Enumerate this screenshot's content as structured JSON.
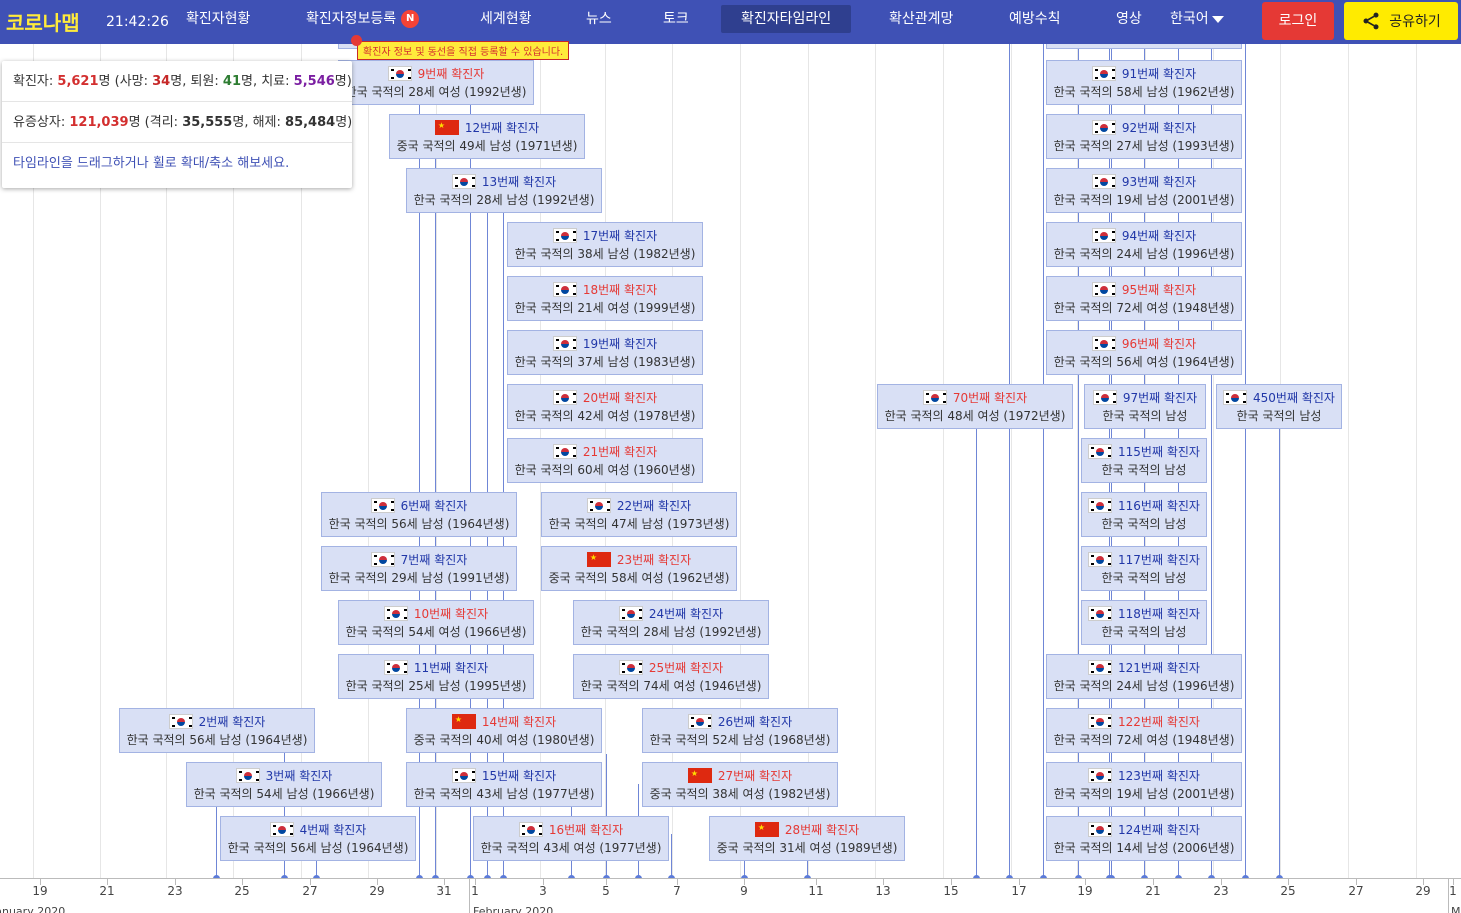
{
  "header": {
    "logo": "코로나맵",
    "clock": "21:42:26",
    "nav": [
      {
        "label": "확진자현황"
      },
      {
        "label": "확진자정보등록",
        "badge": "N"
      },
      {
        "label": "세계현황"
      },
      {
        "label": "뉴스"
      },
      {
        "label": "토크"
      },
      {
        "label": "확진자타임라인",
        "active": true
      },
      {
        "label": "확산관계망"
      },
      {
        "label": "예방수칙"
      },
      {
        "label": "영상"
      },
      {
        "label": "한국어"
      }
    ],
    "login_label": "로그인",
    "share_label": "공유하기",
    "registration_tooltip": "확진자 정보 및 동선을 직접 등록할 수 있습니다."
  },
  "summary": {
    "confirmed_label": "확진자: ",
    "confirmed": "5,621",
    "deaths_label": "명 (사망: ",
    "deaths": "34",
    "discharged_label": "명, 퇴원: ",
    "discharged": "41",
    "treating_label": "명, 치료: ",
    "treating": "5,546",
    "end1": "명)",
    "suspected_label": "유증상자: ",
    "suspected": "121,039",
    "isolated_label": "명 (격리: ",
    "isolated": "35,555",
    "released_label": "명, 해제: ",
    "released": "85,484",
    "end2": "명)",
    "hint": "타임라인을 드래그하거나 휠로 확대/축소 해보세요."
  },
  "axis": {
    "ticks": [
      "19",
      "21",
      "23",
      "25",
      "27",
      "29",
      "31",
      "1",
      "3",
      "5",
      "7",
      "9",
      "11",
      "13",
      "15",
      "17",
      "19",
      "21",
      "23",
      "25",
      "27",
      "29",
      "1"
    ],
    "months": [
      "January 2020",
      "February 2020",
      "M"
    ]
  },
  "cases": [
    {
      "title": "9번째 확진자",
      "desc": "한국 국적의 28세 여성 (1992년생)",
      "flag": "kr",
      "red": true
    },
    {
      "title": "12번째 확진자",
      "desc": "중국 국적의 49세 남성 (1971년생)",
      "flag": "cn",
      "red": false
    },
    {
      "title": "13번째 확진자",
      "desc": "한국 국적의 28세 남성 (1992년생)",
      "flag": "kr",
      "red": false
    },
    {
      "title": "17번째 확진자",
      "desc": "한국 국적의 38세 남성 (1982년생)",
      "flag": "kr",
      "red": false
    },
    {
      "title": "18번째 확진자",
      "desc": "한국 국적의 21세 여성 (1999년생)",
      "flag": "kr",
      "red": true
    },
    {
      "title": "19번째 확진자",
      "desc": "한국 국적의 37세 남성 (1983년생)",
      "flag": "kr",
      "red": false
    },
    {
      "title": "20번째 확진자",
      "desc": "한국 국적의 42세 여성 (1978년생)",
      "flag": "kr",
      "red": true
    },
    {
      "title": "21번째 확진자",
      "desc": "한국 국적의 60세 여성 (1960년생)",
      "flag": "kr",
      "red": true
    },
    {
      "title": "6번째 확진자",
      "desc": "한국 국적의 56세 남성 (1964년생)",
      "flag": "kr",
      "red": false
    },
    {
      "title": "22번째 확진자",
      "desc": "한국 국적의 47세 남성 (1973년생)",
      "flag": "kr",
      "red": false
    },
    {
      "title": "7번째 확진자",
      "desc": "한국 국적의 29세 남성 (1991년생)",
      "flag": "kr",
      "red": false
    },
    {
      "title": "23번째 확진자",
      "desc": "중국 국적의 58세 여성 (1962년생)",
      "flag": "cn",
      "red": true
    },
    {
      "title": "10번째 확진자",
      "desc": "한국 국적의 54세 여성 (1966년생)",
      "flag": "kr",
      "red": true
    },
    {
      "title": "24번째 확진자",
      "desc": "한국 국적의 28세 남성 (1992년생)",
      "flag": "kr",
      "red": false
    },
    {
      "title": "11번째 확진자",
      "desc": "한국 국적의 25세 남성 (1995년생)",
      "flag": "kr",
      "red": false
    },
    {
      "title": "25번째 확진자",
      "desc": "한국 국적의 74세 여성 (1946년생)",
      "flag": "kr",
      "red": true
    },
    {
      "title": "2번째 확진자",
      "desc": "한국 국적의 56세 남성 (1964년생)",
      "flag": "kr",
      "red": false
    },
    {
      "title": "14번째 확진자",
      "desc": "중국 국적의 40세 여성 (1980년생)",
      "flag": "cn",
      "red": true
    },
    {
      "title": "26번째 확진자",
      "desc": "한국 국적의 52세 남성 (1968년생)",
      "flag": "kr",
      "red": false
    },
    {
      "title": "3번째 확진자",
      "desc": "한국 국적의 54세 남성 (1966년생)",
      "flag": "kr",
      "red": false
    },
    {
      "title": "15번째 확진자",
      "desc": "한국 국적의 43세 남성 (1977년생)",
      "flag": "kr",
      "red": false
    },
    {
      "title": "27번째 확진자",
      "desc": "중국 국적의 38세 여성 (1982년생)",
      "flag": "cn",
      "red": true
    },
    {
      "title": "4번째 확진자",
      "desc": "한국 국적의 56세 남성 (1964년생)",
      "flag": "kr",
      "red": false
    },
    {
      "title": "16번째 확진자",
      "desc": "한국 국적의 43세 여성 (1977년생)",
      "flag": "kr",
      "red": true
    },
    {
      "title": "28번째 확진자",
      "desc": "중국 국적의 31세 여성 (1989년생)",
      "flag": "cn",
      "red": true
    },
    {
      "title": "91번째 확진자",
      "desc": "한국 국적의 58세 남성 (1962년생)",
      "flag": "kr",
      "red": false
    },
    {
      "title": "92번째 확진자",
      "desc": "한국 국적의 27세 남성 (1993년생)",
      "flag": "kr",
      "red": false
    },
    {
      "title": "93번째 확진자",
      "desc": "한국 국적의 19세 남성 (2001년생)",
      "flag": "kr",
      "red": false
    },
    {
      "title": "94번째 확진자",
      "desc": "한국 국적의 24세 남성 (1996년생)",
      "flag": "kr",
      "red": false
    },
    {
      "title": "95번째 확진자",
      "desc": "한국 국적의 72세 여성 (1948년생)",
      "flag": "kr",
      "red": true
    },
    {
      "title": "96번째 확진자",
      "desc": "한국 국적의 56세 여성 (1964년생)",
      "flag": "kr",
      "red": true
    },
    {
      "title": "70번째 확진자",
      "desc": "한국 국적의 48세 여성 (1972년생)",
      "flag": "kr",
      "red": true
    },
    {
      "title": "97번째 확진자",
      "desc": "한국 국적의 남성",
      "flag": "kr",
      "red": false
    },
    {
      "title": "450번째 확진자",
      "desc": "한국 국적의 남성",
      "flag": "kr",
      "red": false
    },
    {
      "title": "115번째 확진자",
      "desc": "한국 국적의 남성",
      "flag": "kr",
      "red": false
    },
    {
      "title": "116번째 확진자",
      "desc": "한국 국적의 남성",
      "flag": "kr",
      "red": false
    },
    {
      "title": "117번째 확진자",
      "desc": "한국 국적의 남성",
      "flag": "kr",
      "red": false
    },
    {
      "title": "118번째 확진자",
      "desc": "한국 국적의 남성",
      "flag": "kr",
      "red": false
    },
    {
      "title": "121번째 확진자",
      "desc": "한국 국적의 24세 남성 (1996년생)",
      "flag": "kr",
      "red": false
    },
    {
      "title": "122번째 확진자",
      "desc": "한국 국적의 72세 여성 (1948년생)",
      "flag": "kr",
      "red": true
    },
    {
      "title": "123번째 확진자",
      "desc": "한국 국적의 19세 남성 (2001년생)",
      "flag": "kr",
      "red": false
    },
    {
      "title": "124번째 확진자",
      "desc": "한국 국적의 14세 남성 (2006년생)",
      "flag": "kr",
      "red": false
    }
  ]
}
